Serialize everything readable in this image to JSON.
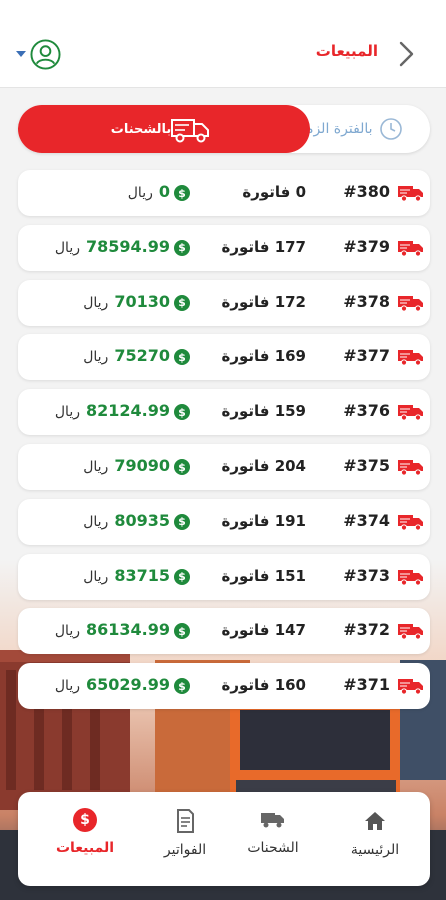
{
  "header": {
    "title": "المبيعات"
  },
  "tabs": {
    "period_label": "بالفترة الزمنية",
    "shipments_label": "بالشحنات"
  },
  "currency": "ريال",
  "unit_invoice": "فاتورة",
  "shipments": [
    {
      "number": "#380",
      "invoices": "0",
      "amount": "0"
    },
    {
      "number": "#379",
      "invoices": "177",
      "amount": "78594.99"
    },
    {
      "number": "#378",
      "invoices": "172",
      "amount": "70130"
    },
    {
      "number": "#377",
      "invoices": "169",
      "amount": "75270"
    },
    {
      "number": "#376",
      "invoices": "159",
      "amount": "82124.99"
    },
    {
      "number": "#375",
      "invoices": "204",
      "amount": "79090"
    },
    {
      "number": "#374",
      "invoices": "191",
      "amount": "80935"
    },
    {
      "number": "#373",
      "invoices": "151",
      "amount": "83715"
    },
    {
      "number": "#372",
      "invoices": "147",
      "amount": "86134.99"
    },
    {
      "number": "#371",
      "invoices": "160",
      "amount": "65029.99"
    }
  ],
  "bottom_nav": {
    "home": "الرئيسية",
    "shipments": "الشحنات",
    "invoices": "الفواتير",
    "sales": "المبيعات"
  },
  "colors": {
    "accent": "#e8262a",
    "money": "#1f8a3c",
    "link": "#7fa8d0"
  },
  "icons": {
    "back": "chevron-right-icon",
    "avatar": "user-circle-icon",
    "dropdown": "caret-down-icon",
    "period": "clock-icon",
    "shipments_tab": "truck-icon",
    "row": "truck-icon",
    "money": "dollar-icon",
    "nav_home": "home-icon",
    "nav_shipments": "truck-icon",
    "nav_invoices": "document-icon",
    "nav_sales": "dollar-icon"
  }
}
